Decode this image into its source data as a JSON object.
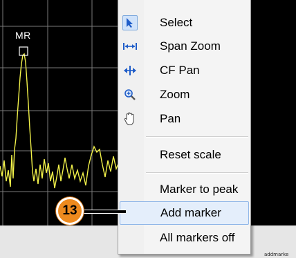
{
  "display": {
    "marker_label": "MR"
  },
  "menu": {
    "items": [
      {
        "label": "Select",
        "icon": "pointer-arrow-icon"
      },
      {
        "label": "Span Zoom",
        "icon": "span-zoom-icon"
      },
      {
        "label": "CF Pan",
        "icon": "cf-pan-icon"
      },
      {
        "label": "Zoom",
        "icon": "magnifier-zoom-icon"
      },
      {
        "label": "Pan",
        "icon": "hand-pan-icon"
      },
      {
        "label": "Reset scale"
      },
      {
        "label": "Marker to peak"
      },
      {
        "label": "Add marker"
      },
      {
        "label": "All markers off"
      }
    ]
  },
  "callout": {
    "number": "13"
  },
  "watermark": "addmarke",
  "colors": {
    "trace": "#f2f24a",
    "menu_highlight": "#e4eefb",
    "callout": "#ee8a1e"
  }
}
